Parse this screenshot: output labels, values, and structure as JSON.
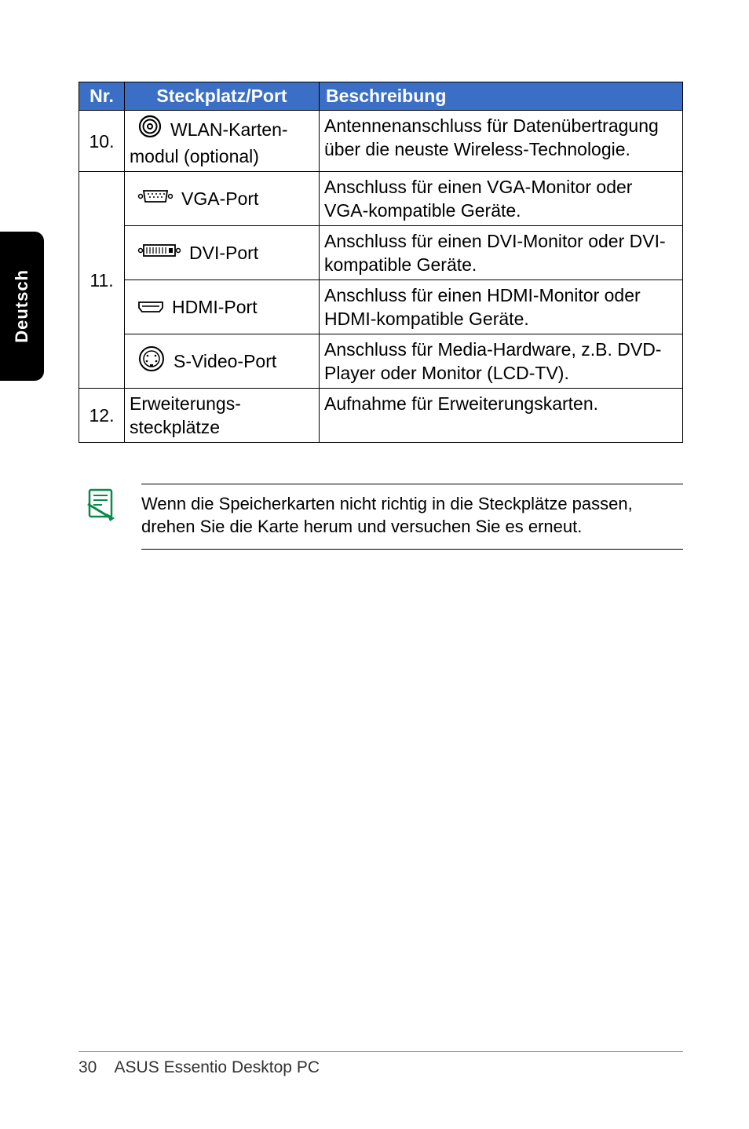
{
  "side_tab": "Deutsch",
  "table": {
    "headers": {
      "nr": "Nr.",
      "slot": "Steckplatz/Port",
      "desc": "Beschreibung"
    },
    "rows": [
      {
        "nr": "10.",
        "sub": [
          {
            "slot_line1": "WLAN-Karten-",
            "slot_line2": "modul (optional)",
            "icon": "antenna",
            "desc": "Antennenanschluss für Datenübertragung über die neuste Wireless-Technologie."
          }
        ]
      },
      {
        "nr": "11.",
        "sub": [
          {
            "slot": "VGA-Port",
            "icon": "vga",
            "desc": "Anschluss für einen VGA-Monitor oder VGA-kompatible Geräte."
          },
          {
            "slot": "DVI-Port",
            "icon": "dvi",
            "desc": "Anschluss für einen DVI-Monitor oder DVI-kompatible Geräte."
          },
          {
            "slot": "HDMI-Port",
            "icon": "hdmi",
            "desc": "Anschluss für einen HDMI-Monitor oder HDMI-kompatible Geräte."
          },
          {
            "slot": "S-Video-Port",
            "icon": "svideo",
            "desc": "Anschluss für Media-Hardware, z.B. DVD-Player oder Monitor (LCD-TV)."
          }
        ]
      },
      {
        "nr": "12.",
        "sub": [
          {
            "slot_line1": "Erweiterungs-",
            "slot_line2": "steckplätze",
            "icon": "none",
            "desc": "Aufnahme für Erweiterungskarten."
          }
        ]
      }
    ]
  },
  "note": "Wenn die Speicherkarten nicht richtig in die Steckplätze passen, drehen Sie die Karte herum und versuchen Sie es erneut.",
  "footer": {
    "page": "30",
    "title": "ASUS Essentio Desktop PC"
  }
}
